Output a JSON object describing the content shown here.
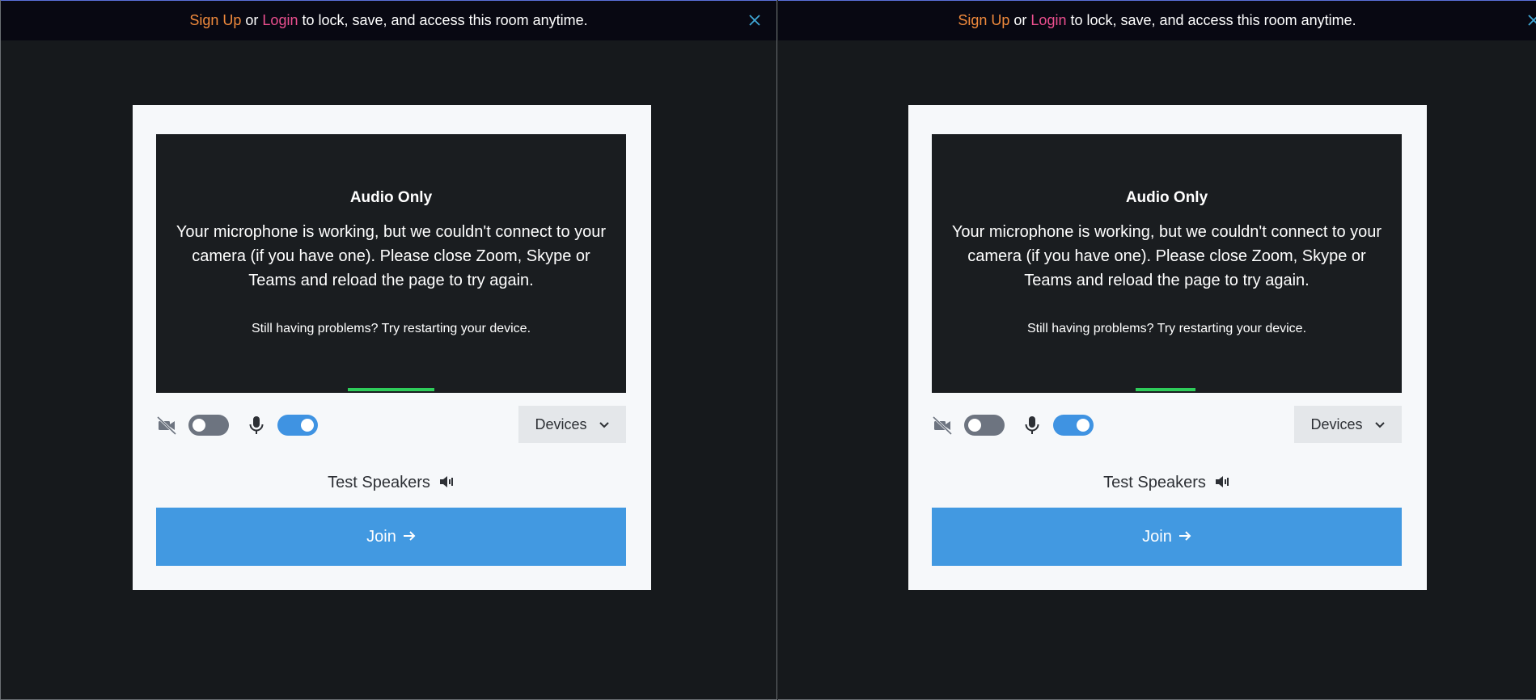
{
  "banner": {
    "signup": "Sign Up",
    "or": "or",
    "login": "Login",
    "rest": "to lock, save, and access this room anytime."
  },
  "preview": {
    "title": "Audio Only",
    "message": "Your microphone is working, but we couldn't connect to your camera (if you have one). Please close Zoom, Skype or Teams and reload the page to try again.",
    "hint": "Still having problems? Try restarting your device."
  },
  "controls": {
    "camera_enabled": false,
    "mic_enabled": true,
    "devices_label": "Devices"
  },
  "test_speakers": "Test Speakers",
  "join_label": "Join",
  "colors": {
    "signup": "#f08a3c",
    "login": "#ec4f8f",
    "toggle_on": "#3f93e2",
    "join": "#4299e1",
    "mic_level": "#2ecc5a"
  },
  "icons": [
    "close-icon",
    "camera-off-icon",
    "microphone-icon",
    "chevron-down-icon",
    "speaker-icon",
    "arrow-right-icon"
  ]
}
